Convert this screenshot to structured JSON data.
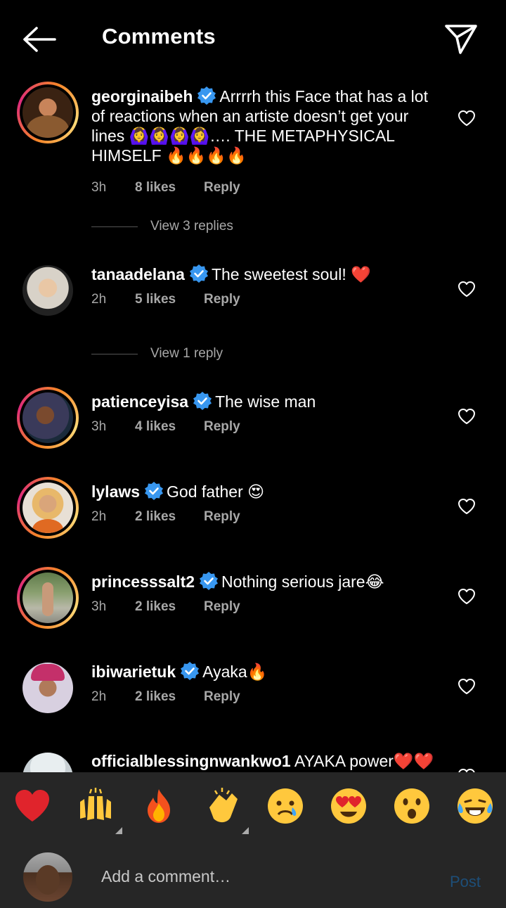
{
  "header": {
    "title": "Comments"
  },
  "comments": [
    {
      "username": "georginaibeh",
      "text": "Arrrrh this Face that has a lot of reactions when an artiste doesn’t get your lines 🙆‍♀️🙆‍♀️🙆‍♀️🙆‍♀️…. THE METAPHYSICAL HIMSELF 🔥🔥🔥🔥",
      "time": "3h",
      "likes": "8 likes",
      "reply": "Reply"
    },
    {
      "username": "tanaadelana",
      "text": "The sweetest soul! ❤️",
      "time": "2h",
      "likes": "5 likes",
      "reply": "Reply"
    },
    {
      "username": "patienceyisa",
      "text": "The wise man",
      "time": "3h",
      "likes": "4 likes",
      "reply": "Reply"
    },
    {
      "username": "lylaws",
      "text": "God father 😍",
      "time": "2h",
      "likes": "2 likes",
      "reply": "Reply"
    },
    {
      "username": "princesssalt2",
      "text": "Nothing serious jare😂",
      "time": "3h",
      "likes": "2 likes",
      "reply": "Reply"
    },
    {
      "username": "ibiwarietuk",
      "text": "Ayaka🔥",
      "time": "2h",
      "likes": "2 likes",
      "reply": "Reply"
    },
    {
      "username": "officialblessingnwankwo1",
      "text": "AYAKA power❤️❤️"
    }
  ],
  "view_replies": [
    "View 3 replies",
    "View 1 reply"
  ],
  "emoji_bar": [
    "red-heart",
    "raising-hands",
    "fire",
    "clapping-hands",
    "crying-face",
    "heart-eyes",
    "surprised-face",
    "tears-of-joy"
  ],
  "input": {
    "placeholder": "Add a comment…",
    "post_label": "Post"
  },
  "colors": {
    "background": "#000000",
    "secondary_text": "#a8a8a8",
    "verified": "#3897f0",
    "post_disabled": "#1d4e78",
    "bar": "#262626"
  }
}
